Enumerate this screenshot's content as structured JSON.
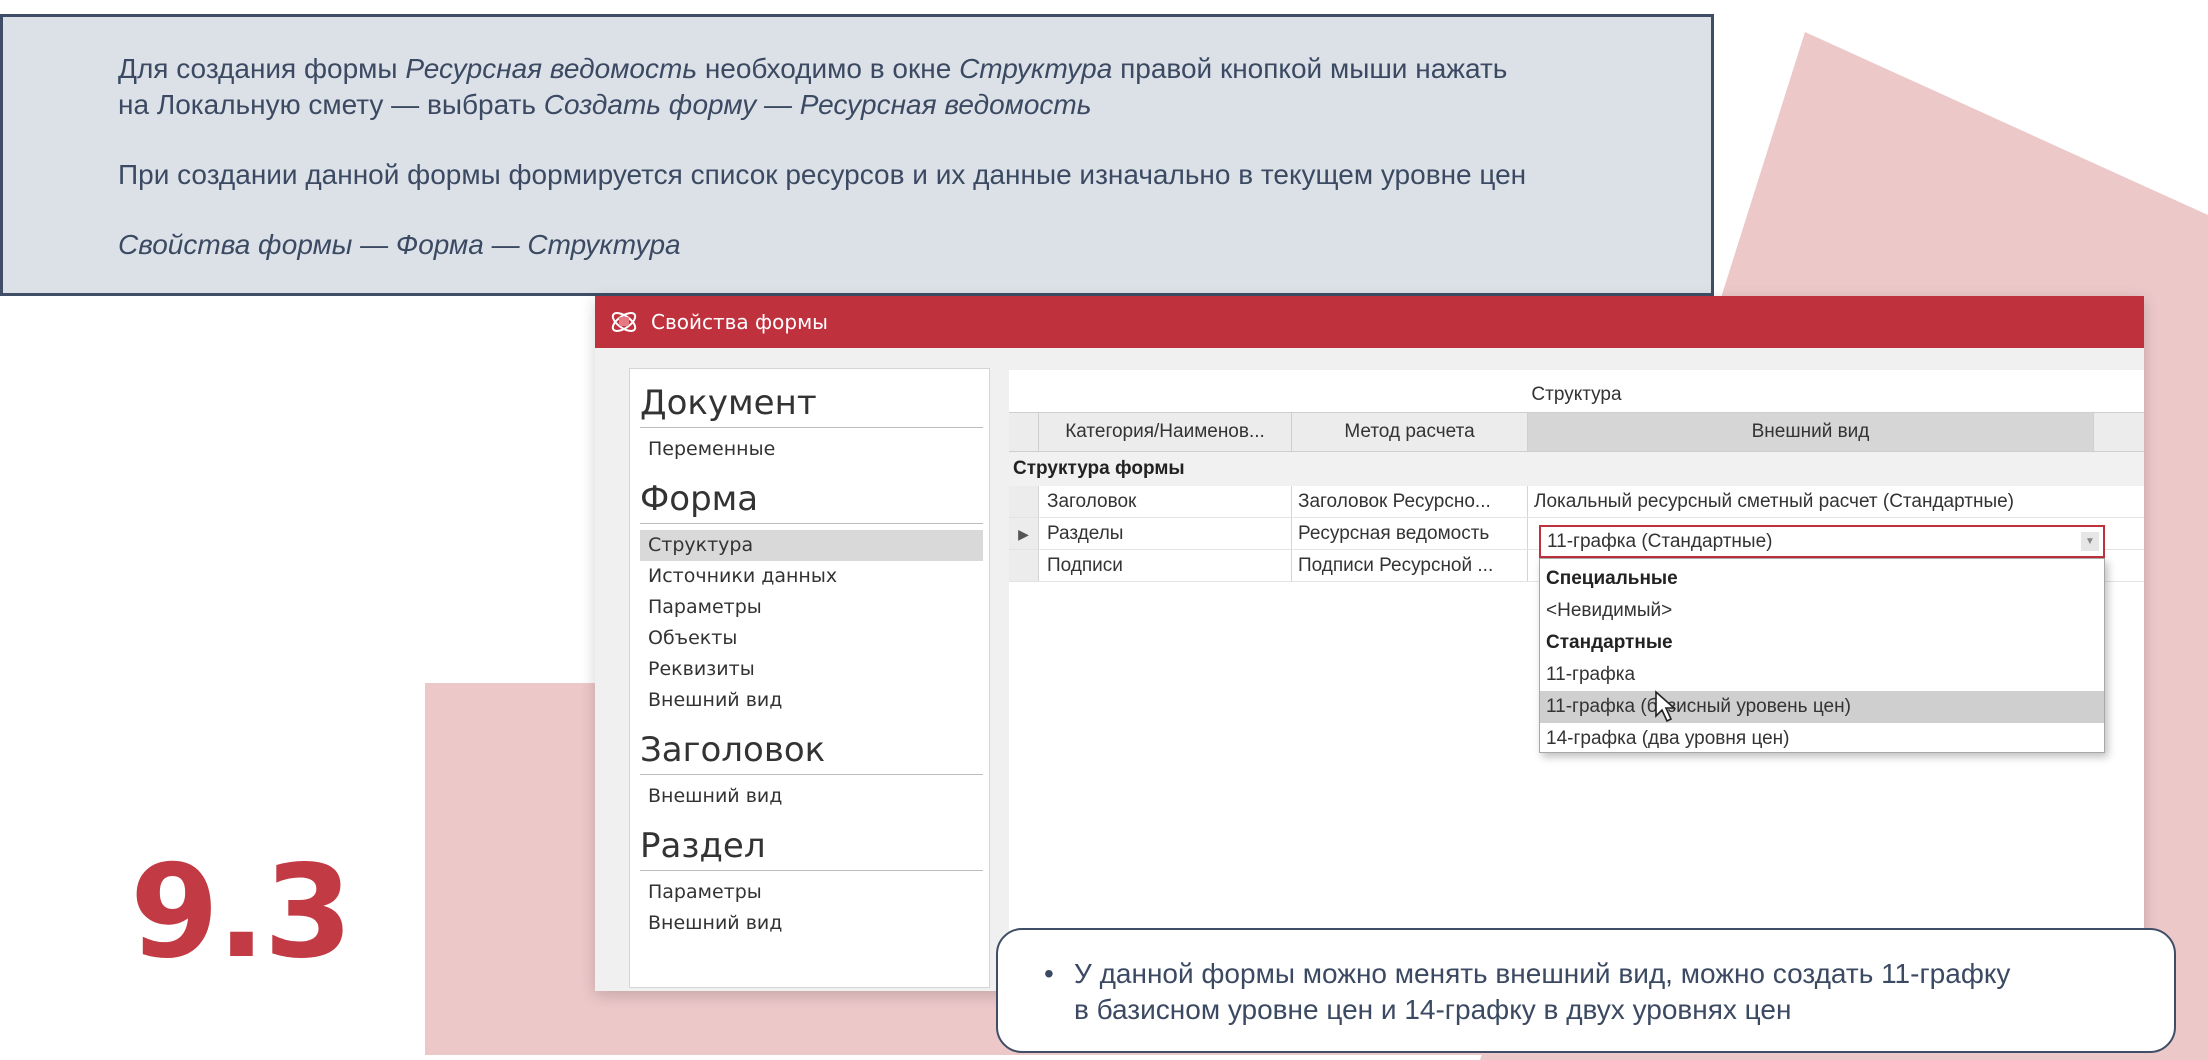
{
  "colors": {
    "accent": "#c0313e",
    "panel": "#dce1e8",
    "panel_border": "#3f4d66",
    "deco_pink": "#ecc8c9",
    "text": "#3b4a62"
  },
  "info": {
    "line1": [
      {
        "text": "Для создания формы ",
        "italic": false
      },
      {
        "text": "Ресурсная ведомость",
        "italic": true
      },
      {
        "text": " необходимо в окне ",
        "italic": false
      },
      {
        "text": "Структура",
        "italic": true
      },
      {
        "text": " правой кнопкой мыши нажать",
        "italic": false
      }
    ],
    "line2": [
      {
        "text": "на Локальную смету — выбрать ",
        "italic": false
      },
      {
        "text": "Создать форму — Ресурсная ведомость",
        "italic": true
      }
    ],
    "line3": "При создании данной формы формируется список ресурсов и их данные изначально в текущем уровне цен",
    "line4": "Свойства формы — Форма — Структура"
  },
  "section_number": "9.3",
  "window": {
    "title": "Свойства формы",
    "icon": "app-logo-icon",
    "nav": {
      "groups": [
        {
          "head": "Документ",
          "items": [
            "Переменные"
          ]
        },
        {
          "head": "Форма",
          "items": [
            "Структура",
            "Источники данных",
            "Параметры",
            "Объекты",
            "Реквизиты",
            "Внешний вид"
          ]
        },
        {
          "head": "Заголовок",
          "items": [
            "Внешний вид"
          ]
        },
        {
          "head": "Раздел",
          "items": [
            "Параметры",
            "Внешний вид"
          ]
        }
      ],
      "selected": "Структура"
    },
    "content": {
      "title": "Структура",
      "columns": [
        "Категория/Наименов...",
        "Метод расчета",
        "Внешний вид"
      ],
      "group_label": "Структура формы",
      "rows": [
        {
          "indicator": "",
          "name": "Заголовок",
          "method": "Заголовок Ресурсно...",
          "view": "Локальный ресурсный сметный расчет (Стандартные)"
        },
        {
          "indicator": "▶",
          "name": "Разделы",
          "method": "Ресурсная ведомость",
          "view": ""
        },
        {
          "indicator": "",
          "name": "Подписи",
          "method": "Подписи Ресурсной ...",
          "view": ""
        }
      ],
      "combo_value": "11-графка (Стандартные)",
      "dropdown": [
        {
          "label": "Специальные",
          "header": true
        },
        {
          "label": "<Невидимый>",
          "header": false
        },
        {
          "label": "Стандартные",
          "header": true
        },
        {
          "label": "11-графка",
          "header": false
        },
        {
          "label": "11-графка (базисный уровень цен)",
          "header": false,
          "hover": true
        },
        {
          "label": "14-графка (два уровня цен)",
          "header": false
        }
      ]
    }
  },
  "callout": {
    "bullet": "•",
    "line1": "У данной формы можно менять внешний вид, можно создать 11-графку",
    "line2": "в базисном уровне цен и 14-графку в двух уровнях цен"
  }
}
